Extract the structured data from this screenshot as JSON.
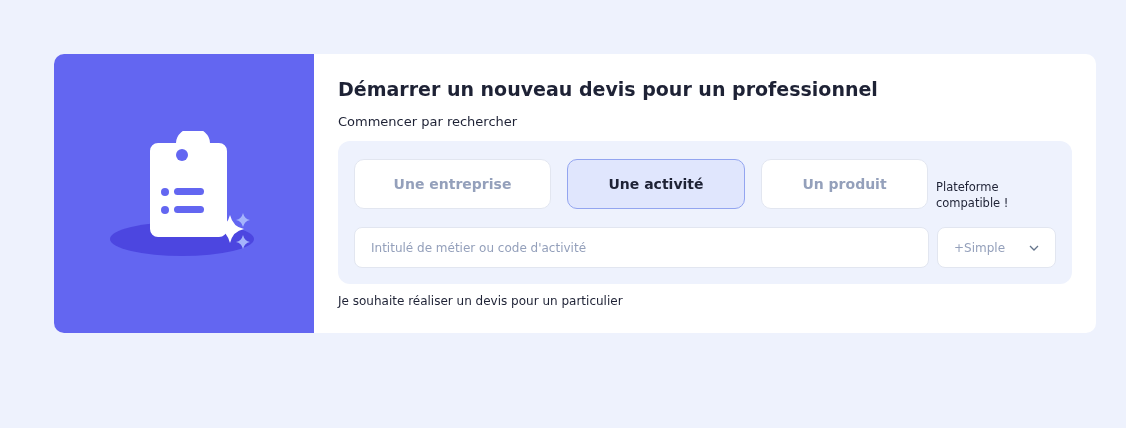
{
  "title": "Démarrer un nouveau devis pour un professionnel",
  "subtitle": "Commencer par rechercher",
  "tabs": [
    {
      "label": "Une entreprise",
      "selected": false
    },
    {
      "label": "Une activité",
      "selected": true
    },
    {
      "label": "Un produit",
      "selected": false
    }
  ],
  "platform_note": "Plateforme compatible !",
  "search": {
    "placeholder": "Intitulé de métier ou code d'activité"
  },
  "mode_select": {
    "value": "+Simple"
  },
  "individual_link": "Je souhaite réaliser un devis pour un particulier"
}
